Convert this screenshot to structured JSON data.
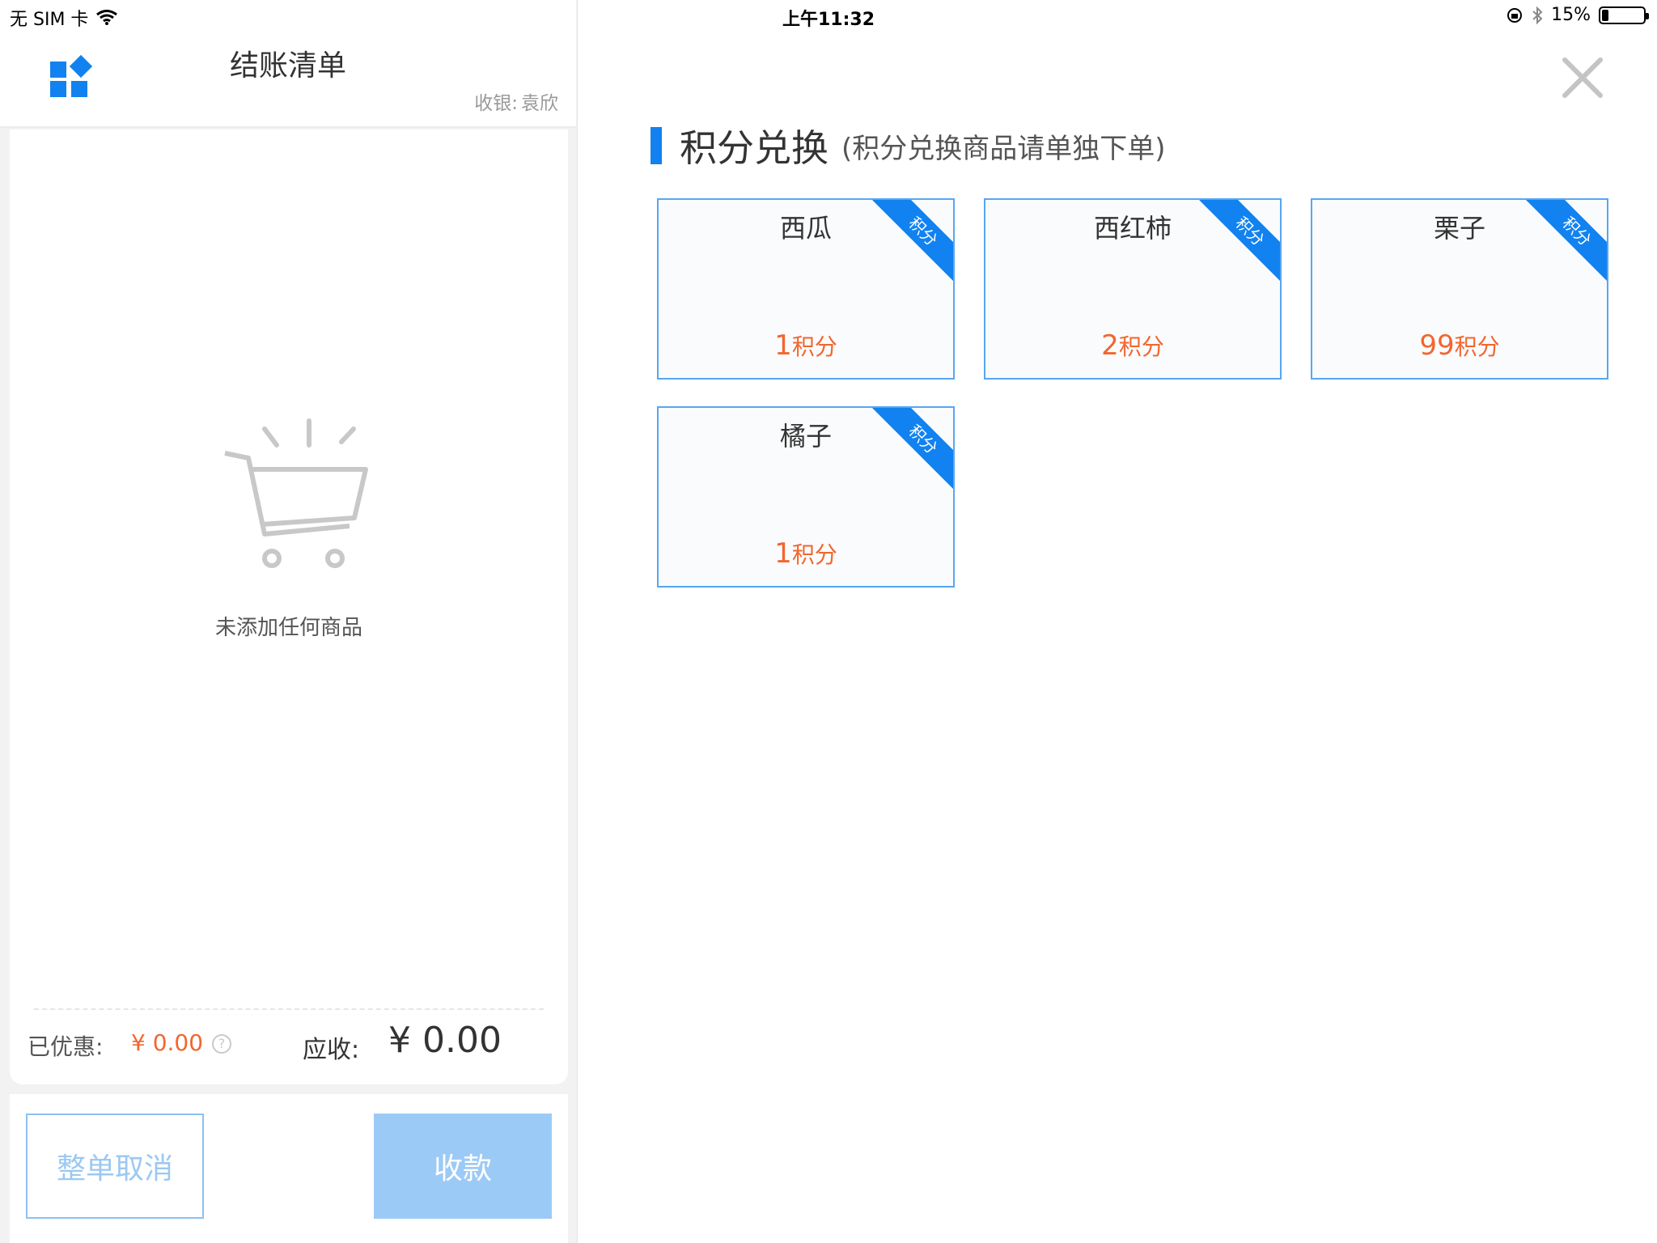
{
  "status_bar": {
    "carrier": "无 SIM 卡",
    "time": "上午11:32",
    "battery_percent": "15%",
    "battery_level": 0.15
  },
  "left_panel": {
    "title": "结账清单",
    "cashier_label": "收银:",
    "cashier_name": "袁欣",
    "empty_message": "未添加任何商品",
    "discount_label": "已优惠:",
    "discount_value": "¥ 0.00",
    "due_label": "应收:",
    "due_value": "¥ 0.00",
    "cancel_button": "整单取消",
    "pay_button": "收款"
  },
  "right_panel": {
    "title": "积分兑换",
    "subtitle": "(积分兑换商品请单独下单)",
    "ribbon_label": "积分",
    "points_unit": "积分",
    "items": [
      {
        "name": "西瓜",
        "points": "1"
      },
      {
        "name": "西红柿",
        "points": "2"
      },
      {
        "name": "栗子",
        "points": "99"
      },
      {
        "name": "橘子",
        "points": "1"
      }
    ]
  },
  "colors": {
    "accent": "#1182f0",
    "points": "#f2662e"
  }
}
